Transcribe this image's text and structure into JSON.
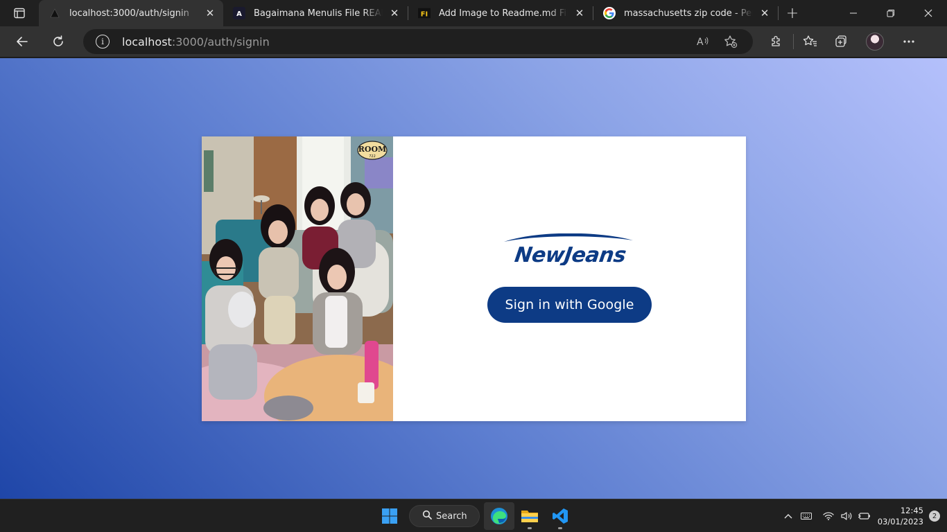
{
  "browser": {
    "tabs": [
      {
        "title": "localhost:3000/auth/signin",
        "favicon": "triangle-icon",
        "active": true
      },
      {
        "title": "Bagaimana Menulis File README",
        "favicon": "a-logo-icon",
        "active": false
      },
      {
        "title": "Add Image to Readme.md File",
        "favicon": "fi-logo-icon",
        "active": false
      },
      {
        "title": "massachusetts zip code - Penelusuran",
        "favicon": "google-icon",
        "active": false
      }
    ],
    "address": {
      "host": "localhost",
      "rest": ":3000/auth/signin"
    }
  },
  "signin": {
    "logo_text": "NewJeans",
    "button_label": "Sign in with Google",
    "photo_sign": "ROOM",
    "photo_sign_sub": "722"
  },
  "taskbar": {
    "search_label": "Search",
    "time": "12:45",
    "date": "03/01/2023",
    "notifications": "2"
  },
  "colors": {
    "brand": "#0d3b85",
    "page_gradient_start": "#b4c0fb",
    "page_gradient_end": "#1f46a8"
  }
}
